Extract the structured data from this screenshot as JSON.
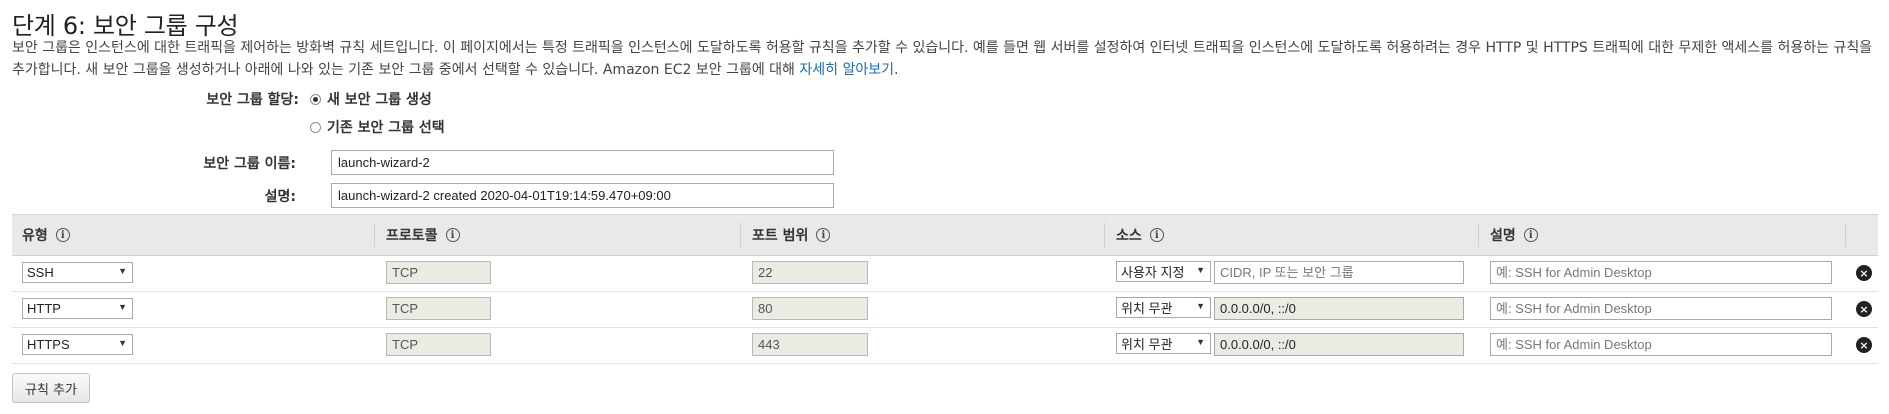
{
  "page": {
    "title": "단계 6: 보안 그룹 구성",
    "description": "보안 그룹은 인스턴스에 대한 트래픽을 제어하는 방화벽 규칙 세트입니다. 이 페이지에서는 특정 트래픽을 인스턴스에 도달하도록 허용할 규칙을 추가할 수 있습니다. 예를 들면 웹 서버를 설정하여 인터넷 트래픽을 인스턴스에 도달하도록 허용하려는 경우 HTTP 및 HTTPS 트래픽에 대한 무제한 액세스를 허용하는 규칙을 추가합니다. 새 보안 그룹을 생성하거나 아래에 나와 있는 기존 보안 그룹 중에서 선택할 수 있습니다. Amazon EC2 보안 그룹에 대해 ",
    "learn_more": "자세히 알아보기",
    "desc_end": "."
  },
  "assign": {
    "label": "보안 그룹 할당:",
    "option_new": "새 보안 그룹 생성",
    "option_existing": "기존 보안 그룹 선택",
    "selected": "new"
  },
  "group_name": {
    "label": "보안 그룹 이름:",
    "value": "launch-wizard-2"
  },
  "group_desc": {
    "label": "설명:",
    "value": "launch-wizard-2 created 2020-04-01T19:14:59.470+09:00"
  },
  "table": {
    "headers": {
      "type": "유형",
      "protocol": "프로토콜",
      "port_range": "포트 범위",
      "source": "소스",
      "description": "설명"
    },
    "info_glyph": "i",
    "delete_glyph": "×",
    "rows": [
      {
        "type": "SSH",
        "protocol": "TCP",
        "port": "22",
        "source_mode": "사용자 지정",
        "source_value": "",
        "source_placeholder": "CIDR, IP 또는 보안 그룹",
        "desc_placeholder": "예: SSH for Admin Desktop"
      },
      {
        "type": "HTTP",
        "protocol": "TCP",
        "port": "80",
        "source_mode": "위치 무관",
        "source_value": "0.0.0.0/0, ::/0",
        "source_placeholder": "",
        "desc_placeholder": "예: SSH for Admin Desktop"
      },
      {
        "type": "HTTPS",
        "protocol": "TCP",
        "port": "443",
        "source_mode": "위치 무관",
        "source_value": "0.0.0.0/0, ::/0",
        "source_placeholder": "",
        "desc_placeholder": "예: SSH for Admin Desktop"
      }
    ]
  },
  "actions": {
    "add_rule": "규칙 추가"
  },
  "colors": {
    "link": "#1a6db5",
    "header_bg": "#e9e9e9",
    "readonly_bg": "#ebebe4"
  }
}
